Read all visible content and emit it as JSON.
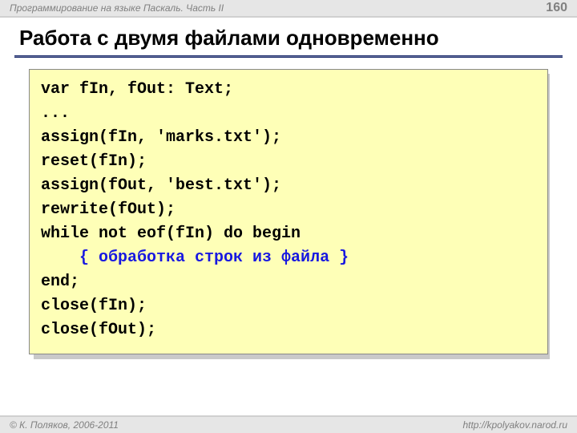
{
  "header": {
    "course": "Программирование на языке Паскаль. Часть II",
    "page": "160"
  },
  "title": "Работа с двумя файлами одновременно",
  "code": {
    "l1": "var fIn, fOut: Text;",
    "l2": "...",
    "l3": "assign(fIn, 'marks.txt');",
    "l4": "reset(fIn);",
    "l5": "assign(fOut, 'best.txt');",
    "l6": "rewrite(fOut);",
    "l7": "while not eof(fIn) do begin",
    "l8_indent": "    ",
    "l8_comment": "{ обработка строк из файла }",
    "l9": "end;",
    "l10": "close(fIn);",
    "l11": "close(fOut);"
  },
  "footer": {
    "left": "© К. Поляков, 2006-2011",
    "right": "http://kpolyakov.narod.ru"
  }
}
